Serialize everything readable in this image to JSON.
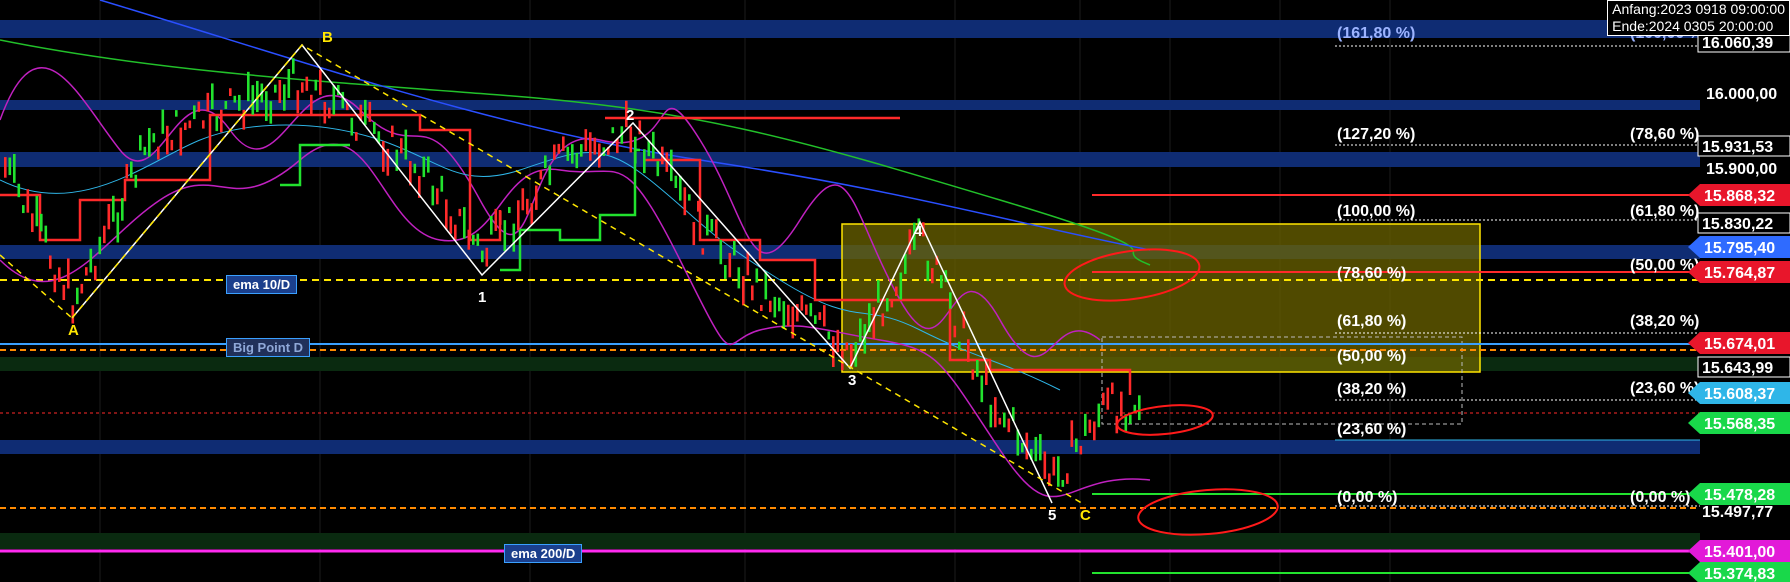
{
  "header": {
    "start_label": "Anfang:2023 0918 09:00:00",
    "end_label": "Ende:2024 0305 20:00:00"
  },
  "indicators": {
    "ema_10": "ema 10/D",
    "big_point": "Big Point D",
    "ema_200": "ema 200/D"
  },
  "wave_labels": [
    "A",
    "B",
    "1",
    "2",
    "3",
    "4",
    "5",
    "C"
  ],
  "fib_left": [
    "(161,80 %)",
    "(127,20 %)",
    "(100,00 %)",
    "(78,60 %)",
    "(61,80 %)",
    "(50,00 %)",
    "(38,20 %)",
    "(23,60 %)",
    "(0,00 %)"
  ],
  "fib_right": [
    "(100,00 %)",
    "(78,60 %)",
    "(61,80 %)",
    "(50,00 %)",
    "(38,20 %)",
    "(23,60 %)",
    "(0,00 %)"
  ],
  "price_scale": [
    "16.060,39",
    "16.000,00",
    "15.931,53",
    "15.900,00",
    "15.830,22",
    "15.643,99",
    "15.497,77"
  ],
  "price_badges": [
    {
      "label": "15.868,32",
      "color": "#e8162b"
    },
    {
      "label": "15.795,40",
      "color": "#2f6bff"
    },
    {
      "label": "15.764,87",
      "color": "#e8162b"
    },
    {
      "label": "15.674,01",
      "color": "#e8162b"
    },
    {
      "label": "15.608,37",
      "color": "#2fb6e8"
    },
    {
      "label": "15.568,35",
      "color": "#19d84a"
    },
    {
      "label": "15.478,28",
      "color": "#19d84a"
    },
    {
      "label": "15.401,00",
      "color": "#e21ad8"
    },
    {
      "label": "15.374,83",
      "color": "#19d84a"
    }
  ],
  "chart_data": {
    "type": "candlestick",
    "symbol": "",
    "ylim": [
      15360,
      16105
    ],
    "grid": true,
    "colors": {
      "up": "#22e22e",
      "down": "#ff2a2a",
      "fib_zone": "#6b6300",
      "band": "#0f2c73",
      "ema200": "#ff2af0"
    }
  }
}
